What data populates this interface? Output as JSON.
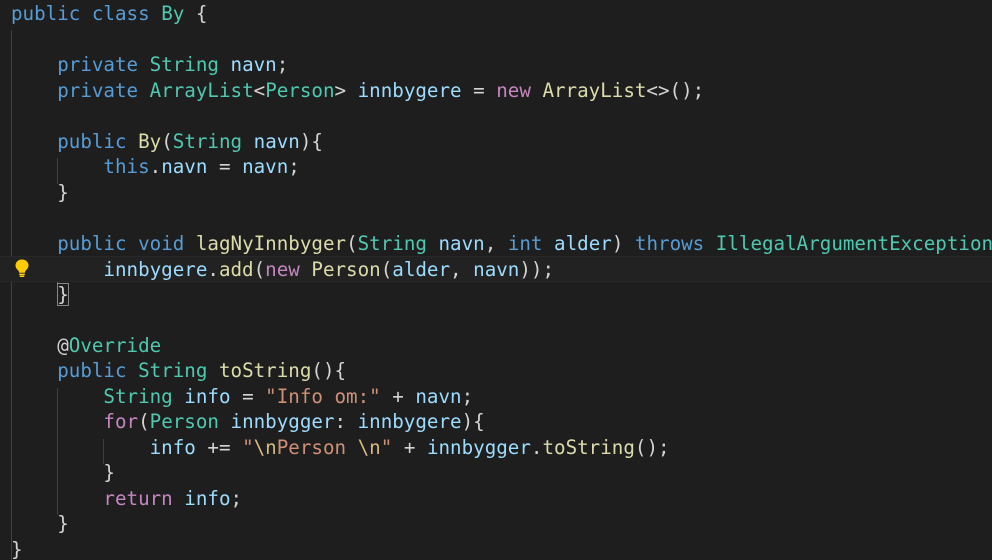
{
  "editor": {
    "theme_colors": {
      "background": "#1e1e1e",
      "keyword": "#569cd6",
      "control": "#c586c0",
      "type": "#4ec9b0",
      "variable": "#9cdcfe",
      "function": "#dcdcaa",
      "string": "#ce9178",
      "punctuation": "#d4d4d4"
    },
    "lightbulb_icon": "lightbulb-icon",
    "lines": [
      [
        {
          "t": "public",
          "c": "kw"
        },
        {
          "t": " "
        },
        {
          "t": "class",
          "c": "kw"
        },
        {
          "t": " "
        },
        {
          "t": "By",
          "c": "ty"
        },
        {
          "t": " {",
          "c": "pun"
        }
      ],
      [],
      [
        {
          "t": "    "
        },
        {
          "t": "private",
          "c": "kw"
        },
        {
          "t": " "
        },
        {
          "t": "String",
          "c": "ty"
        },
        {
          "t": " "
        },
        {
          "t": "navn",
          "c": "var"
        },
        {
          "t": ";",
          "c": "pun"
        }
      ],
      [
        {
          "t": "    "
        },
        {
          "t": "private",
          "c": "kw"
        },
        {
          "t": " "
        },
        {
          "t": "ArrayList",
          "c": "ty"
        },
        {
          "t": "<",
          "c": "pun"
        },
        {
          "t": "Person",
          "c": "ty"
        },
        {
          "t": "> ",
          "c": "pun"
        },
        {
          "t": "innbygere",
          "c": "var"
        },
        {
          "t": " = ",
          "c": "pun"
        },
        {
          "t": "new",
          "c": "ctl"
        },
        {
          "t": " "
        },
        {
          "t": "ArrayList",
          "c": "fn"
        },
        {
          "t": "<>();",
          "c": "pun"
        }
      ],
      [],
      [
        {
          "t": "    "
        },
        {
          "t": "public",
          "c": "kw"
        },
        {
          "t": " "
        },
        {
          "t": "By",
          "c": "fn"
        },
        {
          "t": "(",
          "c": "pun"
        },
        {
          "t": "String",
          "c": "ty"
        },
        {
          "t": " "
        },
        {
          "t": "navn",
          "c": "var"
        },
        {
          "t": "){",
          "c": "pun"
        }
      ],
      [
        {
          "t": "        "
        },
        {
          "t": "this",
          "c": "kw"
        },
        {
          "t": ".",
          "c": "pun"
        },
        {
          "t": "navn",
          "c": "var"
        },
        {
          "t": " = ",
          "c": "pun"
        },
        {
          "t": "navn",
          "c": "var"
        },
        {
          "t": ";",
          "c": "pun"
        }
      ],
      [
        {
          "t": "    "
        },
        {
          "t": "}",
          "c": "pun"
        }
      ],
      [],
      [
        {
          "t": "    "
        },
        {
          "t": "public",
          "c": "kw"
        },
        {
          "t": " "
        },
        {
          "t": "void",
          "c": "kw"
        },
        {
          "t": " "
        },
        {
          "t": "lagNyInnbyger",
          "c": "fn"
        },
        {
          "t": "(",
          "c": "pun"
        },
        {
          "t": "String",
          "c": "ty"
        },
        {
          "t": " "
        },
        {
          "t": "navn",
          "c": "var"
        },
        {
          "t": ", ",
          "c": "pun"
        },
        {
          "t": "int",
          "c": "kw"
        },
        {
          "t": " "
        },
        {
          "t": "alder",
          "c": "var"
        },
        {
          "t": ") ",
          "c": "pun"
        },
        {
          "t": "throws",
          "c": "kw"
        },
        {
          "t": " "
        },
        {
          "t": "IllegalArgumentException",
          "c": "ty"
        },
        {
          "t": "{",
          "c": "pun",
          "b": 1
        }
      ],
      [
        {
          "t": "        "
        },
        {
          "t": "innbygere",
          "c": "var"
        },
        {
          "t": ".",
          "c": "pun"
        },
        {
          "t": "add",
          "c": "fn"
        },
        {
          "t": "(",
          "c": "pun"
        },
        {
          "t": "new",
          "c": "ctl"
        },
        {
          "t": " "
        },
        {
          "t": "Person",
          "c": "fn"
        },
        {
          "t": "(",
          "c": "pun"
        },
        {
          "t": "alder",
          "c": "var"
        },
        {
          "t": ", ",
          "c": "pun"
        },
        {
          "t": "navn",
          "c": "var"
        },
        {
          "t": "));",
          "c": "pun"
        }
      ],
      [
        {
          "t": "    "
        },
        {
          "t": "}",
          "c": "pun",
          "b": 1
        }
      ],
      [],
      [
        {
          "t": "    "
        },
        {
          "t": "@",
          "c": "ann"
        },
        {
          "t": "Override",
          "c": "ty"
        }
      ],
      [
        {
          "t": "    "
        },
        {
          "t": "public",
          "c": "kw"
        },
        {
          "t": " "
        },
        {
          "t": "String",
          "c": "ty"
        },
        {
          "t": " "
        },
        {
          "t": "toString",
          "c": "fn"
        },
        {
          "t": "(){",
          "c": "pun"
        }
      ],
      [
        {
          "t": "        "
        },
        {
          "t": "String",
          "c": "ty"
        },
        {
          "t": " "
        },
        {
          "t": "info",
          "c": "var"
        },
        {
          "t": " = ",
          "c": "pun"
        },
        {
          "t": "\"Info om:\"",
          "c": "str"
        },
        {
          "t": " + ",
          "c": "pun"
        },
        {
          "t": "navn",
          "c": "var"
        },
        {
          "t": ";",
          "c": "pun"
        }
      ],
      [
        {
          "t": "        "
        },
        {
          "t": "for",
          "c": "ctl"
        },
        {
          "t": "(",
          "c": "pun"
        },
        {
          "t": "Person",
          "c": "ty"
        },
        {
          "t": " "
        },
        {
          "t": "innbygger",
          "c": "var"
        },
        {
          "t": ": ",
          "c": "pun"
        },
        {
          "t": "innbygere",
          "c": "var"
        },
        {
          "t": "){",
          "c": "pun"
        }
      ],
      [
        {
          "t": "            "
        },
        {
          "t": "info",
          "c": "var"
        },
        {
          "t": " += ",
          "c": "pun"
        },
        {
          "t": "\"",
          "c": "str"
        },
        {
          "t": "\\n",
          "c": "esc"
        },
        {
          "t": "Person ",
          "c": "str"
        },
        {
          "t": "\\n",
          "c": "esc"
        },
        {
          "t": "\"",
          "c": "str"
        },
        {
          "t": " + ",
          "c": "pun"
        },
        {
          "t": "innbygger",
          "c": "var"
        },
        {
          "t": ".",
          "c": "pun"
        },
        {
          "t": "toString",
          "c": "fn"
        },
        {
          "t": "();",
          "c": "pun"
        }
      ],
      [
        {
          "t": "        "
        },
        {
          "t": "}",
          "c": "pun"
        }
      ],
      [
        {
          "t": "        "
        },
        {
          "t": "return",
          "c": "ctl"
        },
        {
          "t": " "
        },
        {
          "t": "info",
          "c": "var"
        },
        {
          "t": ";",
          "c": "pun"
        }
      ],
      [
        {
          "t": "    "
        },
        {
          "t": "}",
          "c": "pun"
        }
      ],
      [
        {
          "t": "}",
          "c": "pun"
        }
      ]
    ]
  }
}
